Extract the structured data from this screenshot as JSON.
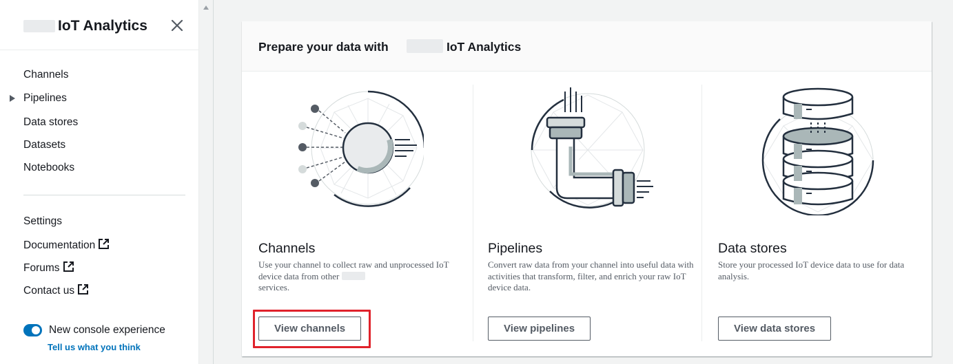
{
  "sidebar": {
    "title": "IoT Analytics",
    "nav": [
      {
        "label": "Channels"
      },
      {
        "label": "Pipelines"
      },
      {
        "label": "Data stores"
      },
      {
        "label": "Datasets"
      },
      {
        "label": "Notebooks"
      }
    ],
    "secondary": [
      {
        "label": "Settings"
      },
      {
        "label": "Documentation"
      },
      {
        "label": "Forums"
      },
      {
        "label": "Contact us"
      }
    ],
    "toggle_label": "New console experience",
    "feedback_link": "Tell us what you think"
  },
  "card": {
    "title_prefix": "Prepare your data with",
    "title_suffix": "IoT Analytics",
    "columns": [
      {
        "heading": "Channels",
        "description": "Use your channel to collect raw and unprocessed IoT device data from other",
        "description_tail": "services.",
        "button": "View channels"
      },
      {
        "heading": "Pipelines",
        "description": "Convert raw data from your channel into useful data with activities that transform, filter, and enrich your raw IoT device data.",
        "button": "View pipelines"
      },
      {
        "heading": "Data stores",
        "description": "Store your processed IoT device data to use for data analysis.",
        "button": "View data stores"
      }
    ]
  },
  "colors": {
    "accent": "#0073bb",
    "highlight": "#e0222b",
    "text": "#16191f",
    "muted": "#545b64"
  }
}
